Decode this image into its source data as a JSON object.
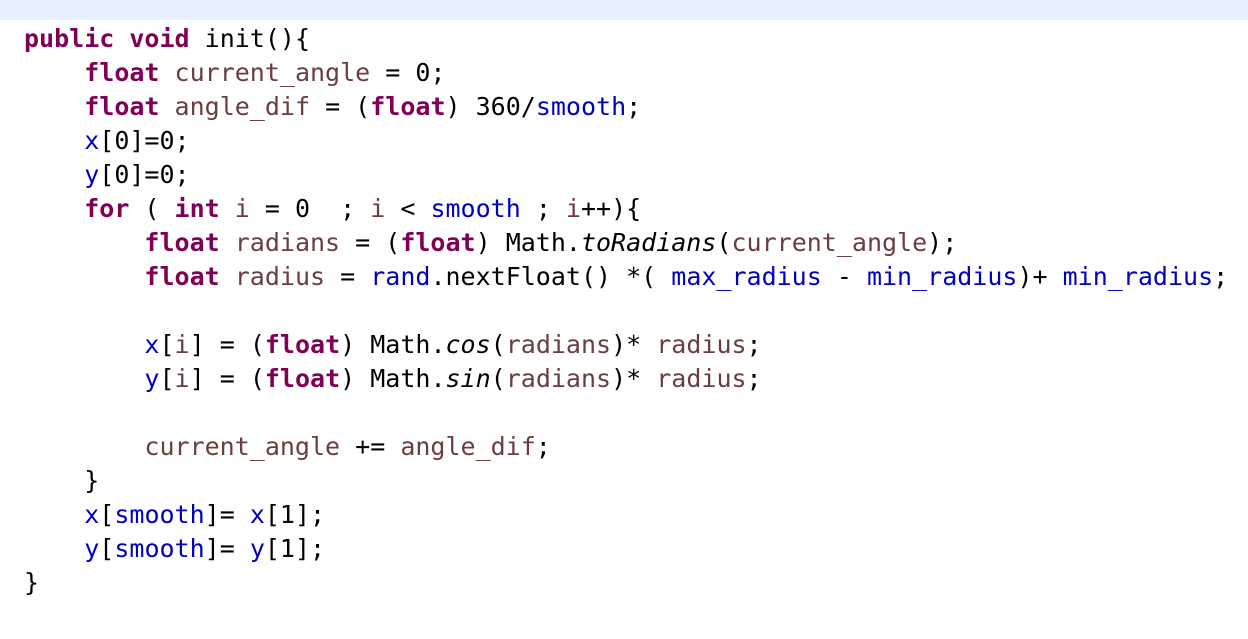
{
  "colors": {
    "keyword": "#7f0055",
    "field": "#0000c0",
    "local_variable": "#6a3e3e",
    "plain": "#000000",
    "top_strip": "#e8f2fe"
  },
  "code": {
    "lines": [
      [
        {
          "t": "public",
          "c": "kw"
        },
        {
          "t": " "
        },
        {
          "t": "void",
          "c": "kw"
        },
        {
          "t": " init(){"
        }
      ],
      [
        {
          "t": "    "
        },
        {
          "t": "float",
          "c": "kw"
        },
        {
          "t": " "
        },
        {
          "t": "current_angle",
          "c": "var"
        },
        {
          "t": " = 0;"
        }
      ],
      [
        {
          "t": "    "
        },
        {
          "t": "float",
          "c": "kw"
        },
        {
          "t": " "
        },
        {
          "t": "angle_dif",
          "c": "var"
        },
        {
          "t": " = ("
        },
        {
          "t": "float",
          "c": "kw"
        },
        {
          "t": ") 360/"
        },
        {
          "t": "smooth",
          "c": "fld"
        },
        {
          "t": ";"
        }
      ],
      [
        {
          "t": "    "
        },
        {
          "t": "x",
          "c": "fld"
        },
        {
          "t": "[0]=0;"
        }
      ],
      [
        {
          "t": "    "
        },
        {
          "t": "y",
          "c": "fld"
        },
        {
          "t": "[0]=0;"
        }
      ],
      [
        {
          "t": "    "
        },
        {
          "t": "for",
          "c": "kw"
        },
        {
          "t": " ( "
        },
        {
          "t": "int",
          "c": "kw"
        },
        {
          "t": " "
        },
        {
          "t": "i",
          "c": "var"
        },
        {
          "t": " = 0  ; "
        },
        {
          "t": "i",
          "c": "var"
        },
        {
          "t": " < "
        },
        {
          "t": "smooth",
          "c": "fld"
        },
        {
          "t": " ; "
        },
        {
          "t": "i",
          "c": "var"
        },
        {
          "t": "++){"
        }
      ],
      [
        {
          "t": "        "
        },
        {
          "t": "float",
          "c": "kw"
        },
        {
          "t": " "
        },
        {
          "t": "radians",
          "c": "var"
        },
        {
          "t": " = ("
        },
        {
          "t": "float",
          "c": "kw"
        },
        {
          "t": ") Math."
        },
        {
          "t": "toRadians",
          "c": "it"
        },
        {
          "t": "("
        },
        {
          "t": "current_angle",
          "c": "var"
        },
        {
          "t": ");"
        }
      ],
      [
        {
          "t": "        "
        },
        {
          "t": "float",
          "c": "kw"
        },
        {
          "t": " "
        },
        {
          "t": "radius",
          "c": "var"
        },
        {
          "t": " = "
        },
        {
          "t": "rand",
          "c": "fld"
        },
        {
          "t": ".nextFloat() *( "
        },
        {
          "t": "max_radius",
          "c": "fld"
        },
        {
          "t": " - "
        },
        {
          "t": "min_radius",
          "c": "fld"
        },
        {
          "t": ")+ "
        },
        {
          "t": "min_radius",
          "c": "fld"
        },
        {
          "t": ";"
        }
      ],
      [],
      [
        {
          "t": "        "
        },
        {
          "t": "x",
          "c": "fld"
        },
        {
          "t": "["
        },
        {
          "t": "i",
          "c": "var"
        },
        {
          "t": "] = ("
        },
        {
          "t": "float",
          "c": "kw"
        },
        {
          "t": ") Math."
        },
        {
          "t": "cos",
          "c": "it"
        },
        {
          "t": "("
        },
        {
          "t": "radians",
          "c": "var"
        },
        {
          "t": ")* "
        },
        {
          "t": "radius",
          "c": "var"
        },
        {
          "t": ";"
        }
      ],
      [
        {
          "t": "        "
        },
        {
          "t": "y",
          "c": "fld"
        },
        {
          "t": "["
        },
        {
          "t": "i",
          "c": "var"
        },
        {
          "t": "] = ("
        },
        {
          "t": "float",
          "c": "kw"
        },
        {
          "t": ") Math."
        },
        {
          "t": "sin",
          "c": "it"
        },
        {
          "t": "("
        },
        {
          "t": "radians",
          "c": "var"
        },
        {
          "t": ")* "
        },
        {
          "t": "radius",
          "c": "var"
        },
        {
          "t": ";"
        }
      ],
      [],
      [
        {
          "t": "        "
        },
        {
          "t": "current_angle",
          "c": "var"
        },
        {
          "t": " += "
        },
        {
          "t": "angle_dif",
          "c": "var"
        },
        {
          "t": ";"
        }
      ],
      [
        {
          "t": "    }"
        }
      ],
      [
        {
          "t": "    "
        },
        {
          "t": "x",
          "c": "fld"
        },
        {
          "t": "["
        },
        {
          "t": "smooth",
          "c": "fld"
        },
        {
          "t": "]= "
        },
        {
          "t": "x",
          "c": "fld"
        },
        {
          "t": "[1];"
        }
      ],
      [
        {
          "t": "    "
        },
        {
          "t": "y",
          "c": "fld"
        },
        {
          "t": "["
        },
        {
          "t": "smooth",
          "c": "fld"
        },
        {
          "t": "]= "
        },
        {
          "t": "y",
          "c": "fld"
        },
        {
          "t": "[1];"
        }
      ],
      [
        {
          "t": "}"
        }
      ]
    ]
  }
}
